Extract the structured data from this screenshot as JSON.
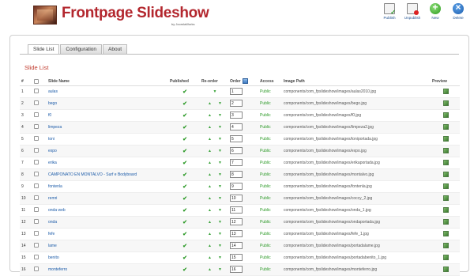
{
  "header": {
    "title": "Frontpage Slideshow",
    "by": "by JoomlaWorks"
  },
  "toolbar": [
    {
      "label": "Publish",
      "icon": "publish-icon"
    },
    {
      "label": "Unpublish",
      "icon": "unpublish-icon"
    },
    {
      "label": "New",
      "icon": "new-icon"
    },
    {
      "label": "Delete",
      "icon": "delete-icon"
    }
  ],
  "tabs": [
    "Slide List",
    "Configuration",
    "About"
  ],
  "section_title": "Slide List",
  "columns": {
    "num": "#",
    "name": "Slide Name",
    "published": "Published",
    "reorder": "Re-order",
    "order": "Order",
    "access": "Access",
    "path": "Image Path",
    "preview": "Preview"
  },
  "rows": [
    {
      "num": "1",
      "name": "aulas",
      "order": "1",
      "access": "Public",
      "path": "components/com_fpslideshow/images/aulas2010.jpg"
    },
    {
      "num": "2",
      "name": "bego",
      "order": "2",
      "access": "Public",
      "path": "components/com_fpslideshow/images/bego.jpg"
    },
    {
      "num": "3",
      "name": "f0",
      "order": "3",
      "access": "Public",
      "path": "components/com_fpslideshow/images/f0.jpg"
    },
    {
      "num": "4",
      "name": "limpeza",
      "order": "4",
      "access": "Public",
      "path": "components/com_fpslideshow/images/limpeza2.jpg"
    },
    {
      "num": "5",
      "name": "toni",
      "order": "5",
      "access": "Public",
      "path": "components/com_fpslideshow/images/toniportada.jpg"
    },
    {
      "num": "6",
      "name": "expo",
      "order": "6",
      "access": "Public",
      "path": "components/com_fpslideshow/images/expo.jpg"
    },
    {
      "num": "7",
      "name": "erika",
      "order": "7",
      "access": "Public",
      "path": "components/com_fpslideshow/images/erikaportada.jpg"
    },
    {
      "num": "8",
      "name": "CAMPONATO EN MONTALVO - Surf e Bodyboard",
      "order": "8",
      "access": "Public",
      "path": "components/com_fpslideshow/images/montalvo.jpg"
    },
    {
      "num": "9",
      "name": "fontenla",
      "order": "9",
      "access": "Public",
      "path": "components/com_fpslideshow/images/fontenla.jpg"
    },
    {
      "num": "10",
      "name": "remri",
      "order": "10",
      "access": "Public",
      "path": "components/com_fpslideshow/images/coccy_2.jpg"
    },
    {
      "num": "11",
      "name": "onda web",
      "order": "11",
      "access": "Public",
      "path": "components/com_fpslideshow/images/onda_1.jpg"
    },
    {
      "num": "12",
      "name": "onda",
      "order": "12",
      "access": "Public",
      "path": "components/com_fpslideshow/images/ondaportada.jpg"
    },
    {
      "num": "13",
      "name": "fefe",
      "order": "13",
      "access": "Public",
      "path": "components/com_fpslideshow/images/fefe_1.jpg"
    },
    {
      "num": "14",
      "name": "lame",
      "order": "14",
      "access": "Public",
      "path": "components/com_fpslideshow/images/portadalame.jpg"
    },
    {
      "num": "15",
      "name": "benito",
      "order": "15",
      "access": "Public",
      "path": "components/com_fpslideshow/images/portadabenito_1.jpg"
    },
    {
      "num": "16",
      "name": "monteferro",
      "order": "16",
      "access": "Public",
      "path": "components/com_fpslideshow/images/monteferro.jpg"
    }
  ]
}
